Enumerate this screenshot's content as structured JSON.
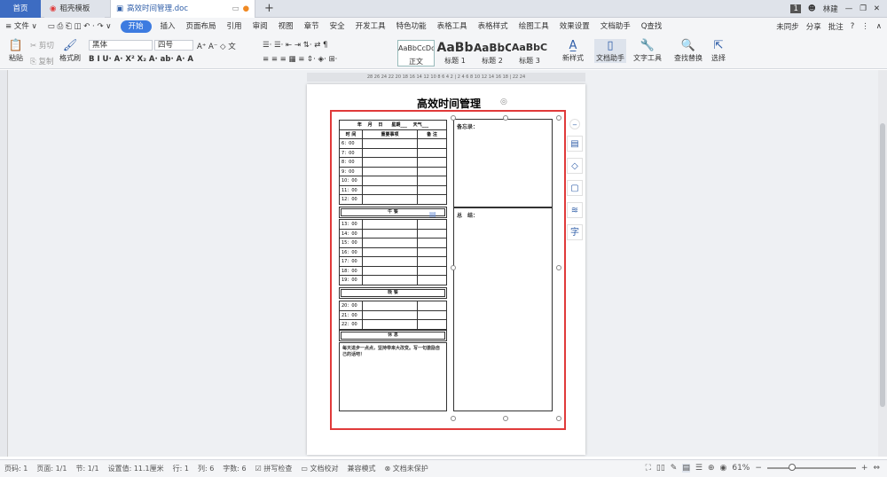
{
  "tabs": {
    "home": "首页",
    "template": "稻壳模板",
    "doc": "高效时间管理.doc"
  },
  "user": {
    "badge": "1",
    "name": "林建"
  },
  "menu": {
    "file": "≡ 文件 ∨",
    "items": [
      "开始",
      "插入",
      "页面布局",
      "引用",
      "审阅",
      "视图",
      "章节",
      "安全",
      "开发工具",
      "特色功能",
      "表格工具",
      "表格样式",
      "绘图工具",
      "效果设置",
      "文档助手"
    ],
    "search": "Q查找",
    "sync": "未同步",
    "share": "分享",
    "comment": "批注"
  },
  "ribbon": {
    "paste": "粘贴",
    "cut": "剪切",
    "copy": "复制",
    "format_painter": "格式刷",
    "font_name": "黑体",
    "font_size": "四号",
    "styles": [
      {
        "preview": "AaBbCcDd",
        "label": "正文"
      },
      {
        "preview": "AaBb",
        "label": "标题 1"
      },
      {
        "preview": "AaBbC",
        "label": "标题 2"
      },
      {
        "preview": "AaBbC",
        "label": "标题 3"
      }
    ],
    "new_style": "新样式",
    "doc_assistant": "文档助手",
    "text_tools": "文字工具",
    "find_replace": "查找替换",
    "select": "选择"
  },
  "ruler": "28 26 24 22 20 18 16 14 12 10 8 6 4 2 | 2 4 6 8 10 12 14 16 18 | 22 24",
  "document": {
    "title": "高效时间管理",
    "header_row": "年　 月　 日　　星期___　 天气___",
    "col_time": "时 间",
    "col_task": "重要事项",
    "col_remark": "备 注",
    "morning_times": [
      "6：00",
      "7：00",
      "8：00",
      "9：00",
      "10：00",
      "11：00",
      "12：00"
    ],
    "lunch": "午 餐",
    "afternoon_times": [
      "13：00",
      "14：00",
      "15：00",
      "16：00",
      "17：00",
      "18：00",
      "19：00"
    ],
    "dinner": "晚 餐",
    "evening_times": [
      "20：00",
      "21：00",
      "22：00"
    ],
    "rest": "休 息",
    "note": "每天进步一点点，坚持带来大改变。写一句激励自己的话吧！",
    "memo_label": "备忘录：",
    "summary_label": "总　结："
  },
  "status": {
    "page": "页码: 1",
    "pages": "页面: 1/1",
    "section": "节: 1/1",
    "setting": "设置值: 11.1厘米",
    "row": "行: 1",
    "col": "列: 6",
    "words": "字数: 6",
    "spell": "拼写检查",
    "proof": "文档校对",
    "compat": "兼容模式",
    "protect": "文档未保护",
    "zoom": "61%"
  }
}
